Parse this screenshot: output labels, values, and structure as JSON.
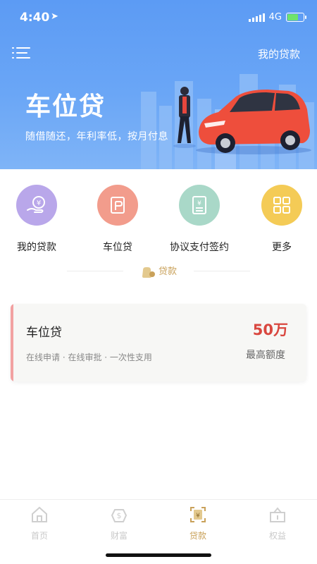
{
  "status_bar": {
    "time": "4:40",
    "network": "4G"
  },
  "header": {
    "right_link": "我的贷款"
  },
  "hero": {
    "title": "车位贷",
    "subtitle": "随借随还，年利率低，按月付息"
  },
  "shortcuts": [
    {
      "label": "我的贷款",
      "icon": "loan-yuan-icon",
      "color": "#b9a7ea"
    },
    {
      "label": "车位贷",
      "icon": "parking-icon",
      "color": "#f29c8c"
    },
    {
      "label": "协议支付签约",
      "icon": "contract-icon",
      "color": "#a9d8c8"
    },
    {
      "label": "更多",
      "icon": "grid-more-icon",
      "color": "#f4cb56"
    }
  ],
  "section": {
    "label": "贷款"
  },
  "loan_card": {
    "title": "车位贷",
    "tags": "在线申请 · 在线审批 · 一次性支用",
    "amount": "50万",
    "amount_label": "最高额度"
  },
  "tabbar": {
    "items": [
      {
        "label": "首页",
        "icon": "home-icon",
        "active": false
      },
      {
        "label": "财富",
        "icon": "wealth-icon",
        "active": false
      },
      {
        "label": "贷款",
        "icon": "loan-icon",
        "active": true
      },
      {
        "label": "权益",
        "icon": "benefits-icon",
        "active": false
      }
    ]
  },
  "colors": {
    "accent": "#c9a15a",
    "amount": "#d9473f",
    "banner": "#5c9bf4"
  }
}
